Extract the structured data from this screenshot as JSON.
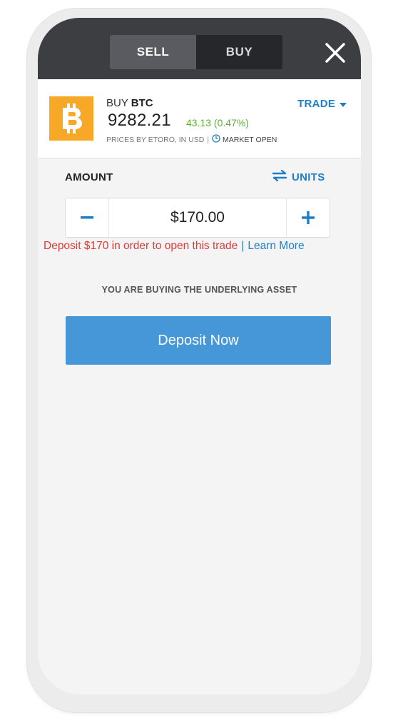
{
  "header": {
    "tabs": [
      {
        "label": "SELL",
        "active": true
      },
      {
        "label": "BUY",
        "active": false
      }
    ],
    "close_icon": "close-icon"
  },
  "asset": {
    "logo_icon": "bitcoin-icon",
    "action": "BUY",
    "symbol": "BTC",
    "price": "9282.21",
    "change": "43.13 (0.47%)",
    "prices_by": "PRICES BY ETORO, IN USD",
    "separator": "|",
    "market_status": "MARKET OPEN",
    "market_icon": "clock-icon",
    "trade_label": "TRADE",
    "trade_icon": "caret-down-icon"
  },
  "order": {
    "amount_label": "AMOUNT",
    "units_label": "UNITS",
    "units_icon": "swap-arrows-icon",
    "amount_value": "$170.00",
    "deposit_warning": "Deposit $170 in order to open this trade",
    "pipe": "|",
    "learn_more": "Learn More",
    "underlying_note": "YOU ARE BUYING THE UNDERLYING ASSET",
    "deposit_button": "Deposit Now"
  },
  "colors": {
    "header_bg": "#3d3e42",
    "accent_blue": "#1f7ec8",
    "button_blue": "#4597d8",
    "warning_red": "#e03a3a",
    "positive_green": "#5cb032",
    "bitcoin_orange": "#f6a826"
  }
}
